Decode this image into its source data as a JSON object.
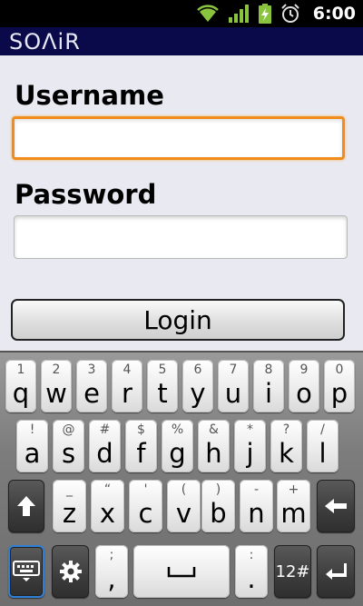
{
  "status_bar": {
    "time": "6:00",
    "icons": [
      "wifi-icon",
      "signal-icon",
      "battery-charging-icon",
      "alarm-clock-icon"
    ],
    "colors": {
      "wifi": "#8ac43e",
      "signal": "#8ac43e",
      "battery": "#8ac43e"
    }
  },
  "app": {
    "logo_text": "SOΛiR",
    "header_color": "#0a0a4a"
  },
  "form": {
    "username_label": "Username",
    "username_value": "",
    "password_label": "Password",
    "password_value": "",
    "login_label": "Login",
    "focus_color": "#f08c1c"
  },
  "keyboard": {
    "row1": [
      {
        "main": "q",
        "hint": "1"
      },
      {
        "main": "w",
        "hint": "2"
      },
      {
        "main": "e",
        "hint": "3"
      },
      {
        "main": "r",
        "hint": "4"
      },
      {
        "main": "t",
        "hint": "5"
      },
      {
        "main": "y",
        "hint": "6"
      },
      {
        "main": "u",
        "hint": "7"
      },
      {
        "main": "i",
        "hint": "8"
      },
      {
        "main": "o",
        "hint": "9"
      },
      {
        "main": "p",
        "hint": "0"
      }
    ],
    "row2": [
      {
        "main": "a",
        "hint": "!"
      },
      {
        "main": "s",
        "hint": "@"
      },
      {
        "main": "d",
        "hint": "#"
      },
      {
        "main": "f",
        "hint": "$"
      },
      {
        "main": "g",
        "hint": "%"
      },
      {
        "main": "h",
        "hint": "&"
      },
      {
        "main": "j",
        "hint": "*"
      },
      {
        "main": "k",
        "hint": "?"
      },
      {
        "main": "l",
        "hint": "/"
      }
    ],
    "row3": [
      {
        "main": "z",
        "hint": "_"
      },
      {
        "main": "x",
        "hint": "“"
      },
      {
        "main": "c",
        "hint": "'"
      },
      {
        "main": "v",
        "hint": "("
      },
      {
        "main": "b",
        "hint": ")"
      },
      {
        "main": "n",
        "hint": "-"
      },
      {
        "main": "m",
        "hint": "+"
      }
    ],
    "row4": {
      "comma_main": ",",
      "comma_hint": ";",
      "period_main": ".",
      "period_hint": ":",
      "symbols_label": "12#"
    },
    "icons": [
      "shift-icon",
      "backspace-icon",
      "keyboard-icon",
      "settings-gear-icon",
      "space-icon",
      "enter-icon"
    ]
  }
}
